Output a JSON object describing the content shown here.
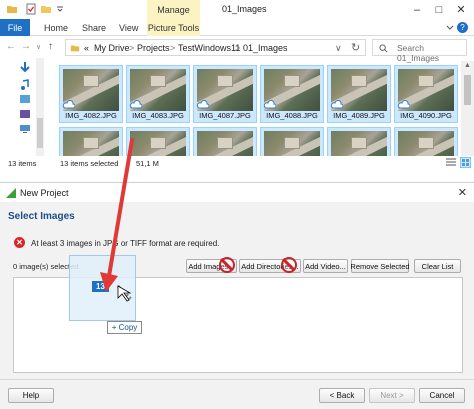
{
  "explorer": {
    "window_title": "01_Images",
    "manage_tab": "Manage",
    "ribbon_tabs": {
      "file": "File",
      "home": "Home",
      "share": "Share",
      "view": "View",
      "picture_tools": "Picture Tools"
    },
    "help": "?",
    "breadcrumb": {
      "chevrons": "«",
      "my_drive": "My Drive",
      "projects": "Projects",
      "test": "TestWindows11",
      "folder": "01_Images"
    },
    "search_placeholder": "Search 01_Images",
    "files": [
      {
        "name": "IMG_4082.JPG"
      },
      {
        "name": "IMG_4083.JPG"
      },
      {
        "name": "IMG_4087.JPG"
      },
      {
        "name": "IMG_4088.JPG"
      },
      {
        "name": "IMG_4089.JPG"
      },
      {
        "name": "IMG_4090.JPG"
      }
    ],
    "status": {
      "items": "13 items",
      "selected": "13 items selected",
      "size": "51,1 M"
    }
  },
  "dialog": {
    "title": "New Project",
    "heading": "Select Images",
    "error": "At least 3 images in JPG or TIFF format are required.",
    "image_count": "0 image(s) selected.",
    "buttons": {
      "add_images": "Add Images...",
      "add_directories": "Add Directories...",
      "add_video": "Add Video...",
      "remove_selected": "Remove Selected",
      "clear_list": "Clear List"
    },
    "footer": {
      "help": "Help",
      "back": "< Back",
      "next": "Next >",
      "cancel": "Cancel"
    }
  },
  "drag": {
    "count": "13",
    "copy_label": "+ Copy"
  },
  "colors": {
    "accent": "#1f6fc5",
    "selection": "#cce8ff",
    "arrow": "#e03a36",
    "error": "#d9262c",
    "no_drop": "#c8232a",
    "picture_tools": "#fbf3c2"
  }
}
